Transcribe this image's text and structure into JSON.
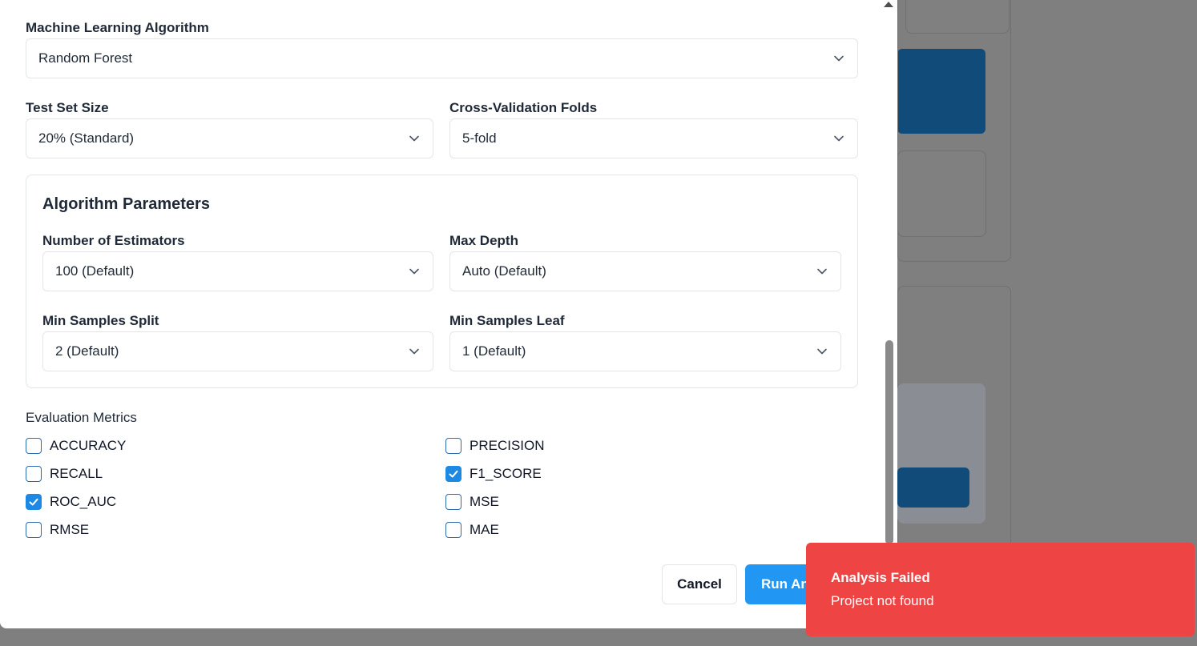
{
  "algorithm": {
    "label": "Machine Learning Algorithm",
    "value": "Random Forest"
  },
  "test_size": {
    "label": "Test Set Size",
    "value": "20% (Standard)"
  },
  "cv_folds": {
    "label": "Cross-Validation Folds",
    "value": "5-fold"
  },
  "params": {
    "title": "Algorithm Parameters",
    "n_estimators": {
      "label": "Number of Estimators",
      "value": "100 (Default)"
    },
    "max_depth": {
      "label": "Max Depth",
      "value": "Auto (Default)"
    },
    "min_samples_split": {
      "label": "Min Samples Split",
      "value": "2 (Default)"
    },
    "min_samples_leaf": {
      "label": "Min Samples Leaf",
      "value": "1 (Default)"
    }
  },
  "metrics": {
    "title": "Evaluation Metrics",
    "items": [
      {
        "label": "ACCURACY",
        "checked": false
      },
      {
        "label": "PRECISION",
        "checked": false
      },
      {
        "label": "RECALL",
        "checked": false
      },
      {
        "label": "F1_SCORE",
        "checked": true
      },
      {
        "label": "ROC_AUC",
        "checked": true
      },
      {
        "label": "MSE",
        "checked": false
      },
      {
        "label": "RMSE",
        "checked": false
      },
      {
        "label": "MAE",
        "checked": false
      }
    ]
  },
  "actions": {
    "cancel": "Cancel",
    "run": "Run Analysis"
  },
  "toast": {
    "title": "Analysis Failed",
    "message": "Project not found",
    "color": "#ef4444"
  },
  "accent_color": "#2196f3"
}
